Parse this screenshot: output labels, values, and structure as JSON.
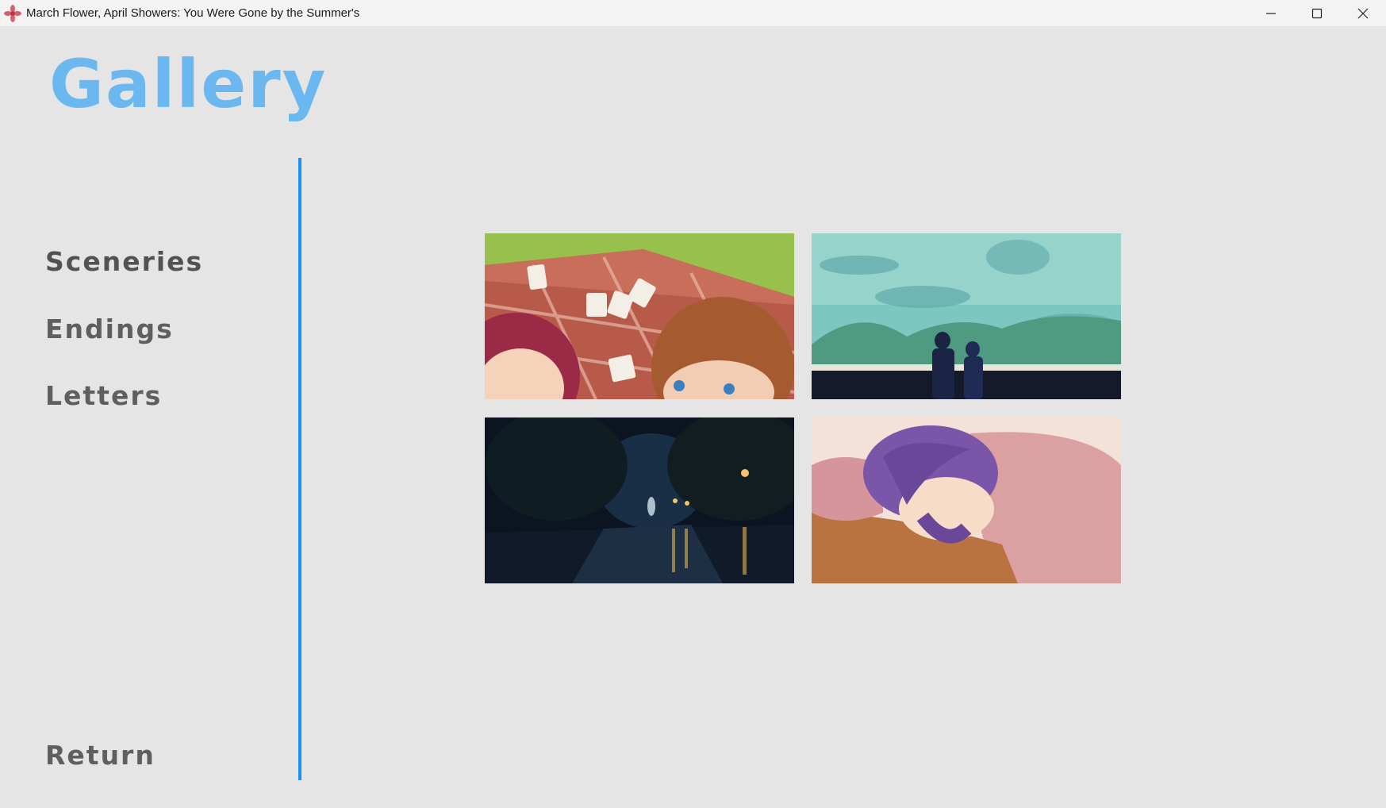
{
  "window": {
    "title": "March Flower, April Showers: You Were Gone by the Summer's",
    "controls": [
      "minimize-icon",
      "maximize-icon",
      "close-icon"
    ]
  },
  "gallery": {
    "title": "Gallery",
    "nav": [
      {
        "label": "Sceneries",
        "active": true
      },
      {
        "label": "Endings",
        "active": false
      },
      {
        "label": "Letters",
        "active": false
      }
    ],
    "return_label": "Return",
    "accent_color": "#6ab8ef",
    "divider_color": "#1c8ff0",
    "thumbnails": [
      {
        "name": "picnic-scene-thumbnail"
      },
      {
        "name": "aquarium-scene-thumbnail"
      },
      {
        "name": "rainy-park-night-thumbnail"
      },
      {
        "name": "sleeping-girl-thumbnail"
      }
    ]
  }
}
